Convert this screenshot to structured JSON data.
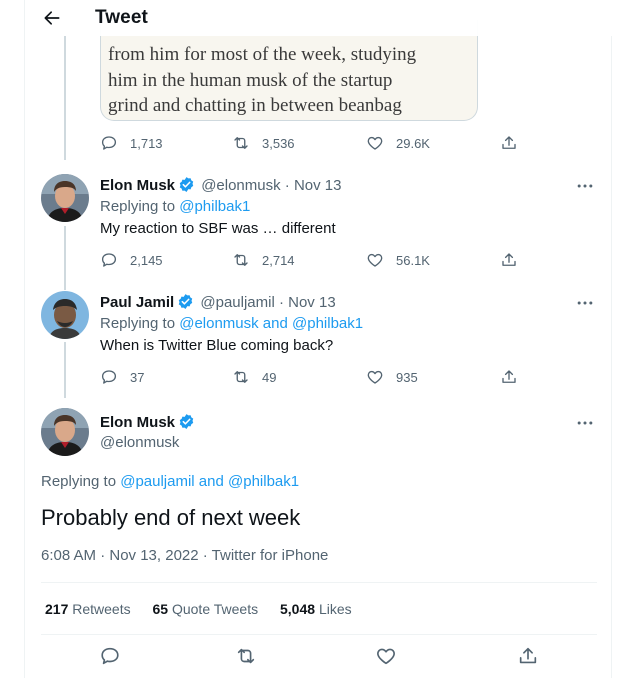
{
  "header": {
    "title": "Tweet"
  },
  "quoted_excerpt": {
    "lines": [
      "from him for most of the week, studying",
      "him in the human musk of the startup",
      "grind and chatting in between beanbag"
    ]
  },
  "first_tweet_actions": {
    "replies": "1,713",
    "retweets": "3,536",
    "likes": "29.6K"
  },
  "replies": [
    {
      "name": "Elon Musk",
      "handle": "@elonmusk",
      "date": "· Nov 13",
      "replying_prefix": "Replying to ",
      "replying_to": "@philbak1",
      "text": "My reaction to SBF was … different",
      "replies": "2,145",
      "retweets": "2,714",
      "likes": "56.1K"
    },
    {
      "name": "Paul Jamil",
      "handle": "@pauljamil",
      "date": "· Nov 13",
      "replying_prefix": "Replying to ",
      "replying_to": "@elonmusk and @philbak1",
      "text": "When is Twitter Blue coming back?",
      "replies": "37",
      "retweets": "49",
      "likes": "935"
    }
  ],
  "main_tweet": {
    "name": "Elon Musk",
    "handle": "@elonmusk",
    "replying_prefix": "Replying to ",
    "replying_to": "@pauljamil and @philbak1",
    "text": "Probably end of next week",
    "timestamp": "6:08 AM · Nov 13, 2022 · Twitter for iPhone",
    "retweets_count": "217",
    "retweets_label": "Retweets",
    "quotes_count": "65",
    "quotes_label": "Quote Tweets",
    "likes_count": "5,048",
    "likes_label": "Likes"
  },
  "colors": {
    "accent": "#1d9bf0",
    "muted": "#536471",
    "text": "#0f1419",
    "divider": "#eff3f4"
  }
}
